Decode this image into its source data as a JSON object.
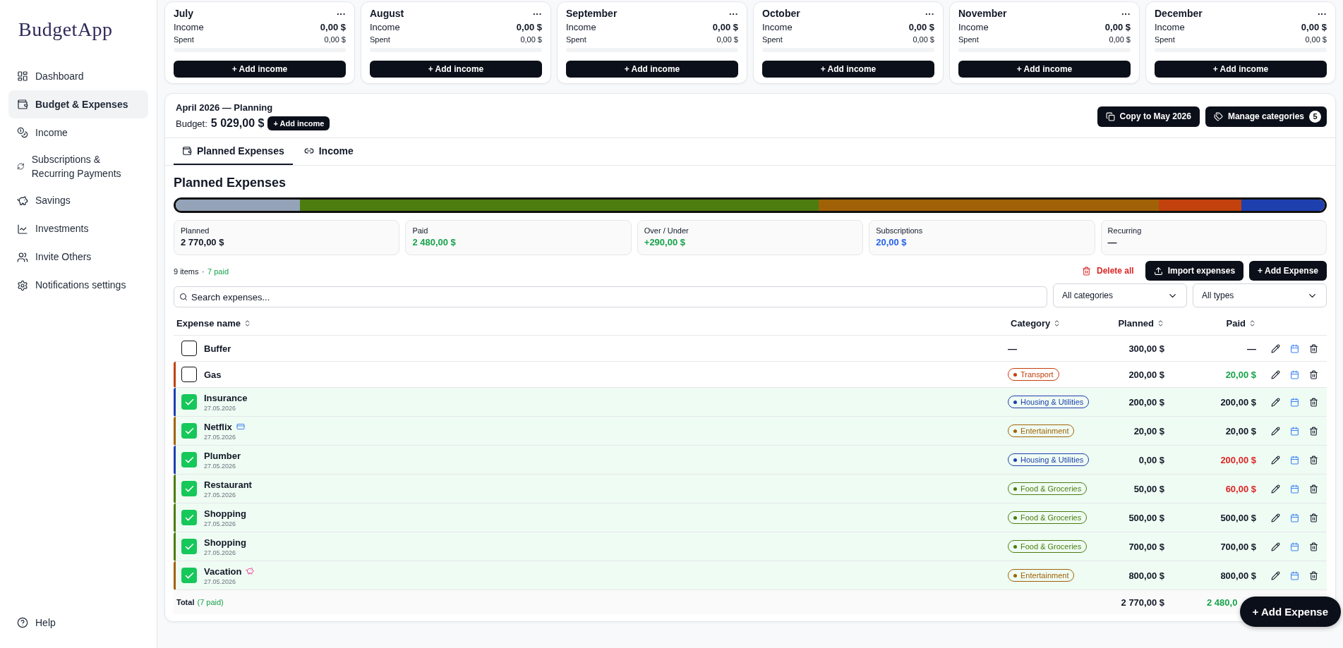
{
  "sidebar": {
    "logo": "BudgetApp",
    "items": [
      {
        "label": "Dashboard",
        "selected": false
      },
      {
        "label": "Budget & Expenses",
        "selected": true
      },
      {
        "label": "Income",
        "selected": false
      },
      {
        "label": "Subscriptions & Recurring Payments",
        "selected": false
      },
      {
        "label": "Savings",
        "selected": false
      },
      {
        "label": "Investments",
        "selected": false
      },
      {
        "label": "Invite Others",
        "selected": false
      },
      {
        "label": "Notifications settings",
        "selected": false
      }
    ],
    "footer": {
      "label": "Help"
    }
  },
  "months": [
    {
      "name": "July",
      "menu": "···",
      "income_label": "Income",
      "income": "0,00 $",
      "spent_label": "Spent",
      "spent": "0,00 $",
      "button": "+ Add income"
    },
    {
      "name": "August",
      "menu": "···",
      "income_label": "Income",
      "income": "0,00 $",
      "spent_label": "Spent",
      "spent": "0,00 $",
      "button": "+ Add income"
    },
    {
      "name": "September",
      "menu": "···",
      "income_label": "Income",
      "income": "0,00 $",
      "spent_label": "Spent",
      "spent": "0,00 $",
      "button": "+ Add income"
    },
    {
      "name": "October",
      "menu": "···",
      "income_label": "Income",
      "income": "0,00 $",
      "spent_label": "Spent",
      "spent": "0,00 $",
      "button": "+ Add income"
    },
    {
      "name": "November",
      "menu": "···",
      "income_label": "Income",
      "income": "0,00 $",
      "spent_label": "Spent",
      "spent": "0,00 $",
      "button": "+ Add income"
    },
    {
      "name": "December",
      "menu": "···",
      "income_label": "Income",
      "income": "0,00 $",
      "spent_label": "Spent",
      "spent": "0,00 $",
      "button": "+ Add income"
    }
  ],
  "plan": {
    "title": "April 2026 — Planning",
    "budget_label": "Budget:",
    "budget": "5 029,00 $",
    "add_income": "+ Add income",
    "copy_button": "Copy to May 2026",
    "categories_button": "Manage categories",
    "categories_count": "5",
    "tabs": [
      {
        "label": "Planned Expenses",
        "selected": true
      },
      {
        "label": "Income",
        "selected": false
      }
    ],
    "heading": "Planned Expenses",
    "segments": [
      {
        "color": "#94a3b8"
      },
      {
        "color": "#4d7c0f"
      },
      {
        "color": "#a16207"
      },
      {
        "color": "#c2410c"
      },
      {
        "color": "#1e40af"
      }
    ],
    "stats": [
      {
        "label": "Planned",
        "value": "2 770,00 $",
        "color": "#111827"
      },
      {
        "label": "Paid",
        "value": "2 480,00 $",
        "color": "#16a34a"
      },
      {
        "label": "Over / Under",
        "value": "+290,00 $",
        "color": "#16a34a"
      },
      {
        "label": "Subscriptions",
        "value": "20,00 $",
        "color": "#2563eb"
      },
      {
        "label": "Recurring",
        "value": "—",
        "color": "#111827"
      }
    ],
    "summary": {
      "count": "9 items",
      "separator": "·",
      "paid": "7 paid"
    },
    "delete_all": "Delete all",
    "import_button": "Import expenses",
    "add_button": "+ Add Expense",
    "search": {
      "placeholder": "Search expenses..."
    },
    "category_filter": "All categories",
    "type_filter": "All types",
    "columns": [
      "Expense name",
      "Category",
      "Planned",
      "Paid"
    ],
    "rows": [
      {
        "name": "Buffer",
        "checked": false,
        "kind": "plain",
        "category": {
          "label": "—"
        },
        "planned": "300,00 $",
        "paid": {
          "value": "—",
          "color": "#111827"
        }
      },
      {
        "name": "Gas",
        "checked": false,
        "kind": "plain",
        "category": {
          "label": "Transport",
          "color": "#c2410c"
        },
        "planned": "200,00 $",
        "paid": {
          "value": "20,00 $",
          "color": "#16a34a"
        }
      },
      {
        "name": "Insurance",
        "date": "27.05.2026",
        "checked": true,
        "kind": "plain",
        "category": {
          "label": "Housing & Utilities",
          "color": "#1e40af"
        },
        "planned": "200,00 $",
        "paid": {
          "value": "200,00 $",
          "color": "#111827"
        }
      },
      {
        "name": "Netflix",
        "date": "27.05.2026",
        "checked": true,
        "kind": "subscription",
        "category": {
          "label": "Entertainment",
          "color": "#a16207"
        },
        "planned": "20,00 $",
        "paid": {
          "value": "20,00 $",
          "color": "#111827"
        }
      },
      {
        "name": "Plumber",
        "date": "27.05.2026",
        "checked": true,
        "kind": "plain",
        "category": {
          "label": "Housing & Utilities",
          "color": "#1e40af"
        },
        "planned": "0,00 $",
        "paid": {
          "value": "200,00 $",
          "color": "#dc2626"
        }
      },
      {
        "name": "Restaurant",
        "date": "27.05.2026",
        "checked": true,
        "kind": "plain",
        "category": {
          "label": "Food & Groceries",
          "color": "#4d7c0f"
        },
        "planned": "50,00 $",
        "paid": {
          "value": "60,00 $",
          "color": "#dc2626"
        }
      },
      {
        "name": "Shopping",
        "date": "27.05.2026",
        "checked": true,
        "kind": "plain",
        "category": {
          "label": "Food & Groceries",
          "color": "#4d7c0f"
        },
        "planned": "500,00 $",
        "paid": {
          "value": "500,00 $",
          "color": "#111827"
        }
      },
      {
        "name": "Shopping",
        "date": "27.05.2026",
        "checked": true,
        "kind": "plain",
        "category": {
          "label": "Food & Groceries",
          "color": "#4d7c0f"
        },
        "planned": "700,00 $",
        "paid": {
          "value": "700,00 $",
          "color": "#111827"
        }
      },
      {
        "name": "Vacation",
        "date": "27.05.2026",
        "checked": true,
        "kind": "savings",
        "category": {
          "label": "Entertainment",
          "color": "#a16207"
        },
        "planned": "800,00 $",
        "paid": {
          "value": "800,00 $",
          "color": "#111827"
        }
      }
    ],
    "total": {
      "label": "Total",
      "paid_note": "(7 paid)",
      "planned": "2 770,00 $",
      "paid": "2 480,0"
    },
    "floating_button": "+ Add Expense"
  }
}
